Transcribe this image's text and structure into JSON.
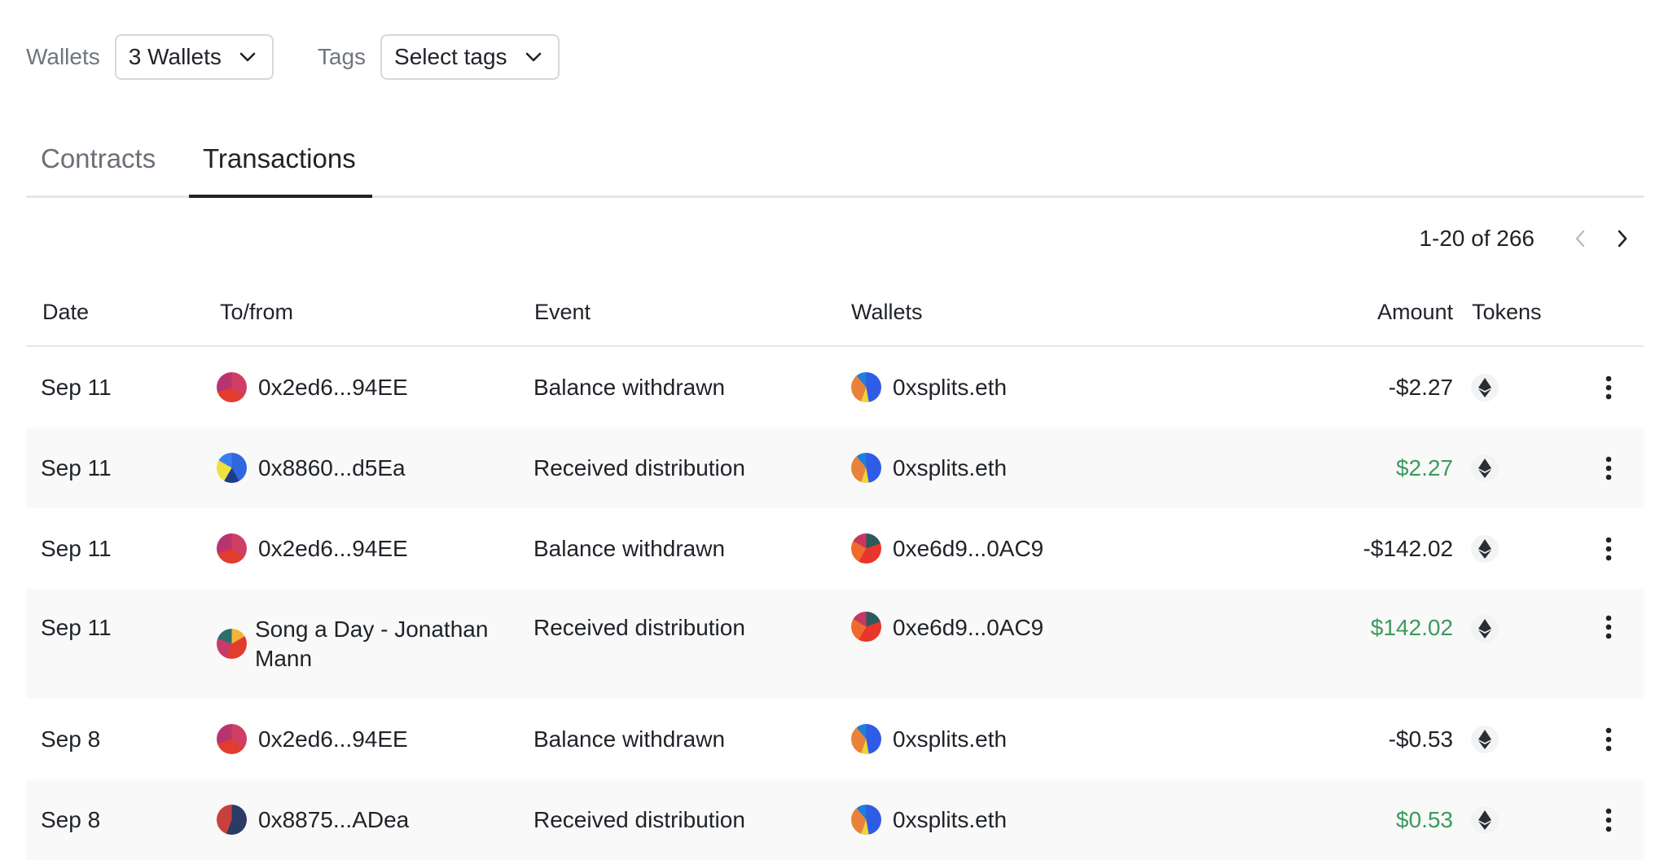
{
  "filters": {
    "wallets_label": "Wallets",
    "wallets_value": "3 Wallets",
    "tags_label": "Tags",
    "tags_placeholder": "Select tags"
  },
  "tabs": [
    {
      "label": "Contracts",
      "active": false
    },
    {
      "label": "Transactions",
      "active": true
    }
  ],
  "pagination": {
    "info": "1-20 of 266"
  },
  "table": {
    "headers": {
      "date": "Date",
      "tofrom": "To/from",
      "event": "Event",
      "wallets": "Wallets",
      "amount": "Amount",
      "tokens": "Tokens"
    },
    "rows": [
      {
        "date": "Sep 11",
        "tofrom": "0x2ed6...94EE",
        "event": "Balance withdrawn",
        "wallet": "0xsplits.eth",
        "amount": "-$2.27",
        "token": "eth-icon"
      },
      {
        "date": "Sep 11",
        "tofrom": "0x8860...d5Ea",
        "event": "Received distribution",
        "wallet": "0xsplits.eth",
        "amount": "$2.27",
        "token": "eth-icon"
      },
      {
        "date": "Sep 11",
        "tofrom": "0x2ed6...94EE",
        "event": "Balance withdrawn",
        "wallet": "0xe6d9...0AC9",
        "amount": "-$142.02",
        "token": "eth-icon"
      },
      {
        "date": "Sep 11",
        "tofrom": "Song a Day - Jonathan Mann",
        "event": "Received distribution",
        "wallet": "0xe6d9...0AC9",
        "amount": "$142.02",
        "token": "eth-icon"
      },
      {
        "date": "Sep 8",
        "tofrom": "0x2ed6...94EE",
        "event": "Balance withdrawn",
        "wallet": "0xsplits.eth",
        "amount": "-$0.53",
        "token": "eth-icon"
      },
      {
        "date": "Sep 8",
        "tofrom": "0x8875...ADea",
        "event": "Received distribution",
        "wallet": "0xsplits.eth",
        "amount": "$0.53",
        "token": "eth-icon"
      }
    ]
  },
  "colors": {
    "positive_amount": "#3c9a5e",
    "active_tab_underline": "#1f2328",
    "row_alt_bg": "#f8f9f8"
  }
}
